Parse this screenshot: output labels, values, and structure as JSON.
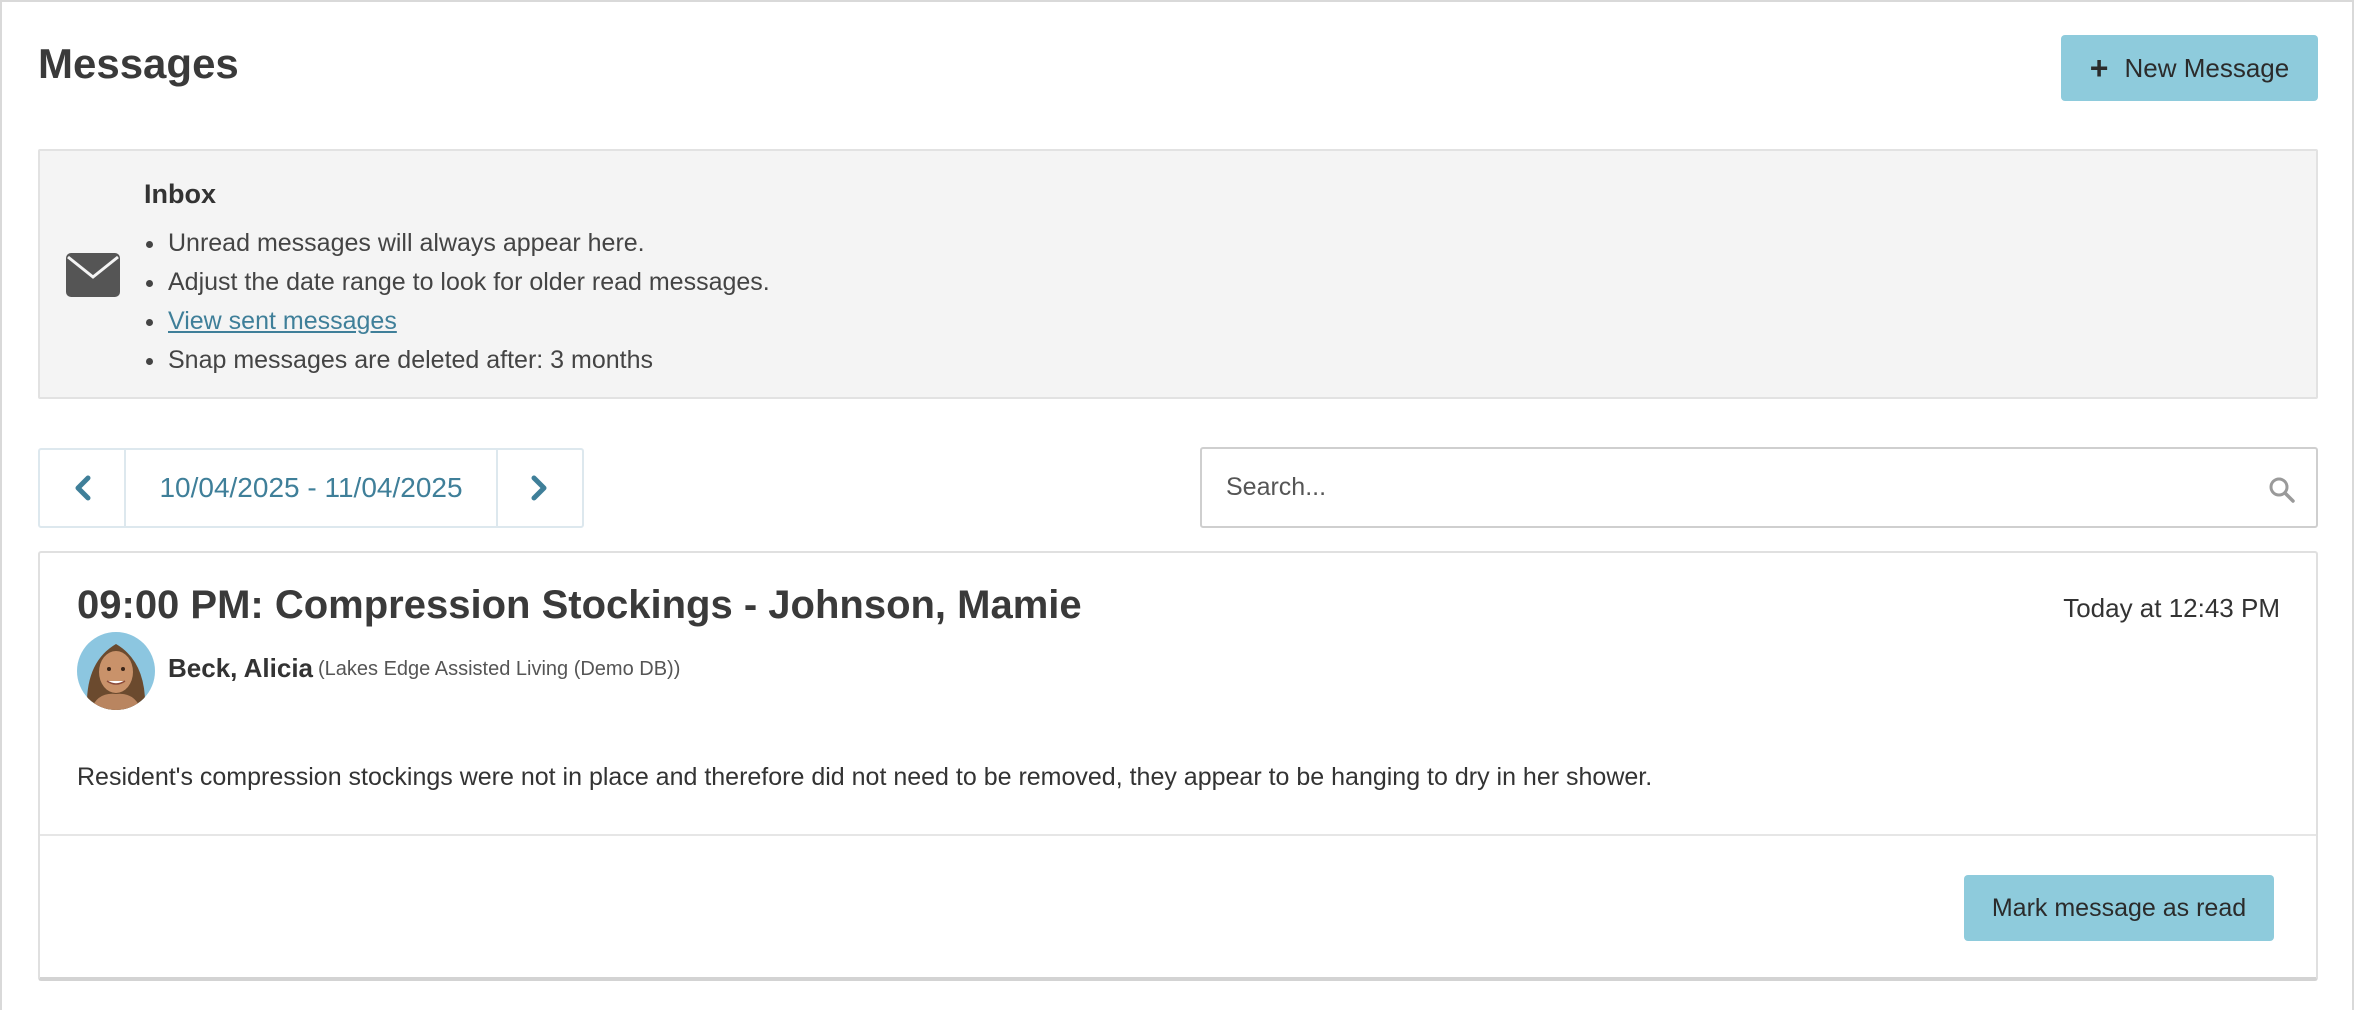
{
  "header": {
    "title": "Messages",
    "new_message_label": "New Message",
    "new_message_icon": "plus-icon"
  },
  "inbox_info": {
    "icon": "envelope-icon",
    "title": "Inbox",
    "items": [
      "Unread messages will always appear here.",
      "Adjust the date range to look for older read messages.",
      "View sent messages",
      "Snap messages are deleted after: 3 months"
    ]
  },
  "date_range": {
    "prev_icon": "chevron-left-icon",
    "label": "10/04/2025 - 11/04/2025",
    "next_icon": "chevron-right-icon"
  },
  "search": {
    "placeholder": "Search...",
    "value": "",
    "icon": "search-icon"
  },
  "message": {
    "title": "09:00 PM: Compression Stockings - Johnson, Mamie",
    "time": "Today at 12:43 PM",
    "sender_name": "Beck, Alicia",
    "sender_org": "(Lakes Edge Assisted Living (Demo DB))",
    "body": "Resident's compression stockings were not in place and therefore did not need to be removed, they appear to be hanging to dry in her shower.",
    "mark_read_label": "Mark message as read"
  },
  "colors": {
    "accent_button": "#8ecbdc",
    "link": "#3f7f99",
    "info_bg": "#f4f4f4"
  }
}
